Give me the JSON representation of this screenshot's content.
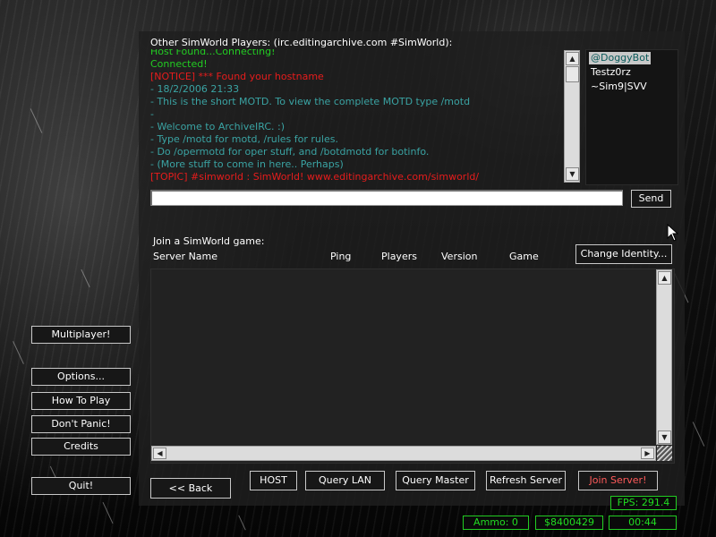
{
  "chat": {
    "title": "Other SimWorld Players: (irc.editingarchive.com #SimWorld):",
    "lines": [
      {
        "text": "Host Found...Connecting!",
        "color": "green"
      },
      {
        "text": "Connected!",
        "color": "green"
      },
      {
        "text": "[NOTICE] *** Found your hostname",
        "color": "red"
      },
      {
        "text": "- 18/2/2006 21:33",
        "color": "teal"
      },
      {
        "text": "- This is the short MOTD. To view the complete MOTD type /motd",
        "color": "teal"
      },
      {
        "text": "-",
        "color": "teal"
      },
      {
        "text": "- Welcome to ArchiveIRC. :)",
        "color": "teal"
      },
      {
        "text": "- Type /motd for motd, /rules for rules.",
        "color": "teal"
      },
      {
        "text": "- Do /opermotd for oper stuff, and /botdmotd for botinfo.",
        "color": "teal"
      },
      {
        "text": "- (More stuff to come in here.. Perhaps)",
        "color": "teal"
      },
      {
        "text": "[TOPIC] #simworld : SimWorld! www.editingarchive.com/simworld/",
        "color": "red"
      }
    ],
    "input_value": "",
    "send_label": "Send"
  },
  "users": [
    {
      "name": "@DoggyBot",
      "selected": true
    },
    {
      "name": "Testz0rz",
      "selected": false
    },
    {
      "name": "~Sim9|SVV",
      "selected": false
    }
  ],
  "servers": {
    "title": "Join a SimWorld game:",
    "columns": [
      "Server Name",
      "Ping",
      "Players",
      "Version",
      "Game"
    ],
    "rows": [],
    "change_identity_label": "Change Identity..."
  },
  "menu": {
    "multiplayer": "Multiplayer!",
    "options": "Options...",
    "how_to_play": "How To Play",
    "dont_panic": "Don't Panic!",
    "credits": "Credits",
    "quit": "Quit!"
  },
  "actions": {
    "back": "<< Back",
    "host": "HOST",
    "query_lan": "Query LAN",
    "query_master": "Query Master",
    "refresh_server": "Refresh Server",
    "join_server": "Join Server!"
  },
  "hud": {
    "fps": "FPS: 291.4",
    "ammo": "Ammo: 0",
    "money": "$8400429",
    "time": "00:44"
  },
  "colors": {
    "chat_teal": "#3aa3a3",
    "chat_red": "#e61c1c",
    "chat_green": "#22cc22",
    "hud_green": "#22dd22",
    "join_red": "#ff5a5a"
  }
}
